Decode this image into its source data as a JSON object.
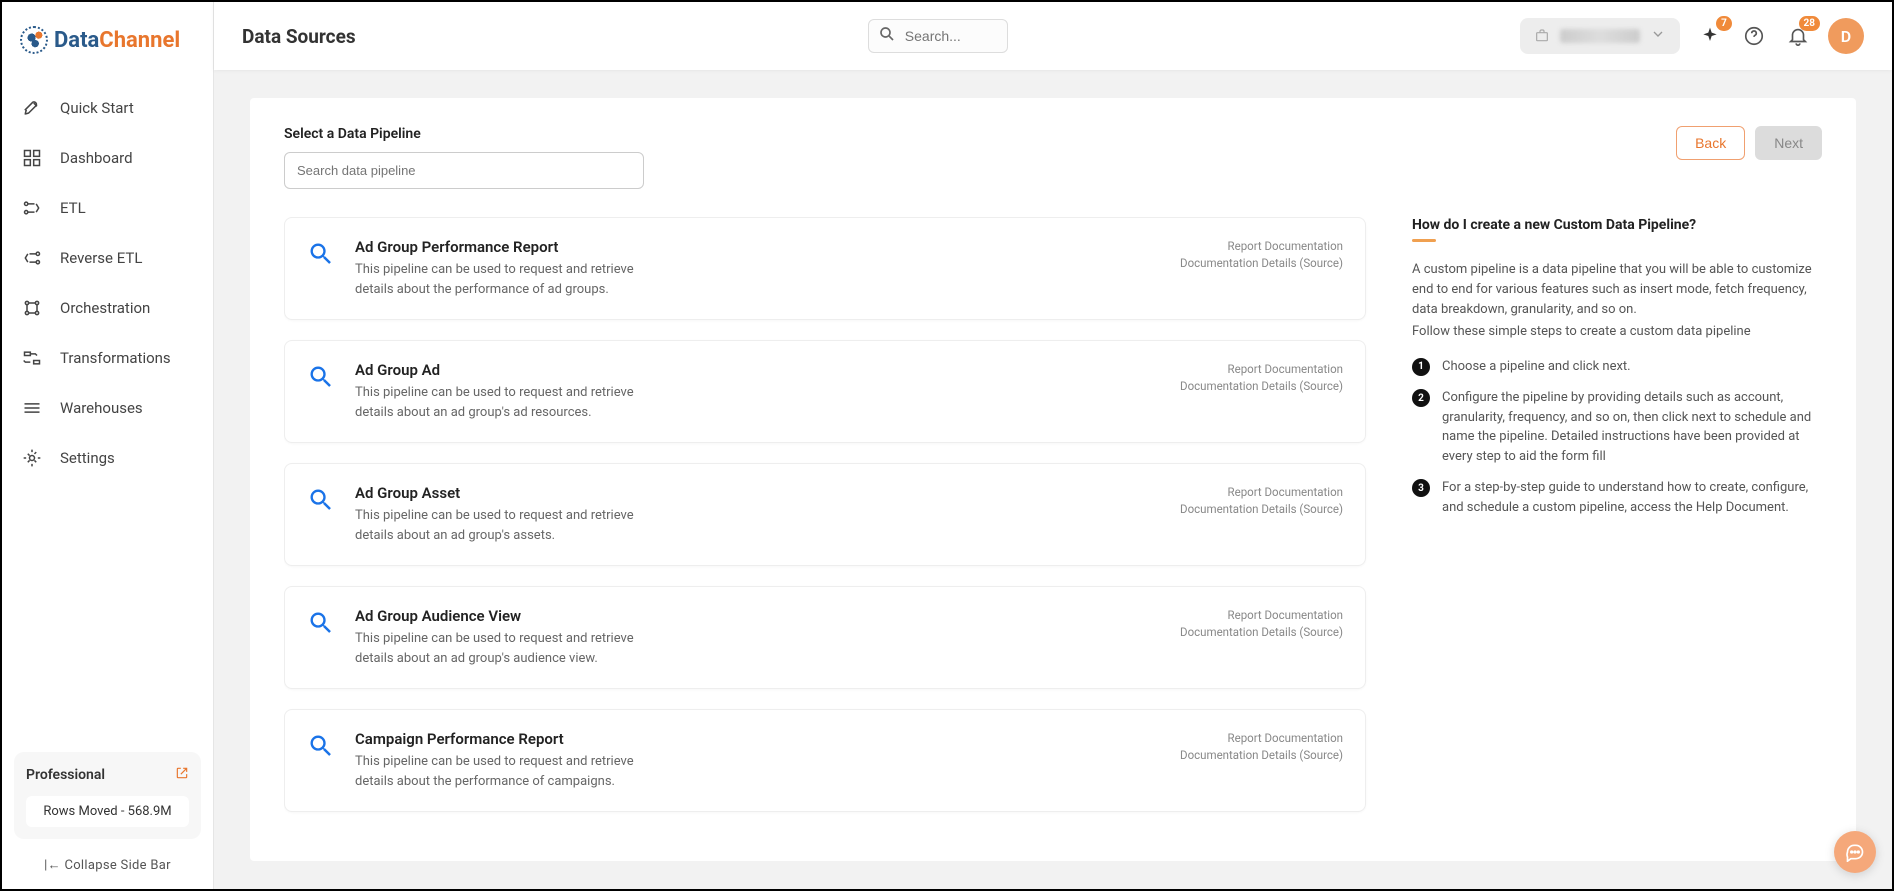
{
  "brand": {
    "prefix": "Data",
    "suffix": "Channel"
  },
  "nav": {
    "items": [
      {
        "label": "Quick Start",
        "icon": "rocket"
      },
      {
        "label": "Dashboard",
        "icon": "grid"
      },
      {
        "label": "ETL",
        "icon": "etl"
      },
      {
        "label": "Reverse ETL",
        "icon": "reverse"
      },
      {
        "label": "Orchestration",
        "icon": "orchestration"
      },
      {
        "label": "Transformations",
        "icon": "transform"
      },
      {
        "label": "Warehouses",
        "icon": "warehouse"
      },
      {
        "label": "Settings",
        "icon": "gear"
      }
    ]
  },
  "plan": {
    "name": "Professional",
    "rows_stat": "Rows Moved - 568.9M"
  },
  "collapse_label": "Collapse Side Bar",
  "header": {
    "title": "Data Sources",
    "search_placeholder": "Search...",
    "sparkle_badge": "7",
    "bell_badge": "28",
    "avatar_initial": "D"
  },
  "content": {
    "section_title": "Select a Data Pipeline",
    "search_placeholder": "Search data pipeline",
    "back_label": "Back",
    "next_label": "Next",
    "doc_link_1": "Report Documentation",
    "doc_link_2": "Documentation Details (Source)",
    "pipelines": [
      {
        "title": "Ad Group Performance Report",
        "desc": "This pipeline can be used to request and retrieve details about the performance of ad groups."
      },
      {
        "title": "Ad Group Ad",
        "desc": "This pipeline can be used to request and retrieve details about an ad group's ad resources."
      },
      {
        "title": "Ad Group Asset",
        "desc": "This pipeline can be used to request and retrieve details about an ad group's assets."
      },
      {
        "title": "Ad Group Audience View",
        "desc": "This pipeline can be used to request and retrieve details about an ad group's audience view."
      },
      {
        "title": "Campaign Performance Report",
        "desc": "This pipeline can be used to request and retrieve details about the performance of campaigns."
      }
    ]
  },
  "help": {
    "title": "How do I create a new Custom Data Pipeline?",
    "para1": "A custom pipeline is a data pipeline that you will be able to customize end to end for various features such as insert mode, fetch frequency, data breakdown, granularity, and so on.",
    "para2": "Follow these simple steps to create a custom data pipeline",
    "steps": [
      "Choose a pipeline and click next.",
      "Configure the pipeline by providing details such as account, granularity, frequency, and so on, then click next to schedule and name the pipeline. Detailed instructions have been provided at every step to aid the form fill",
      "For a step-by-step guide to understand how to create, configure, and schedule a custom pipeline, access the Help Document."
    ]
  }
}
